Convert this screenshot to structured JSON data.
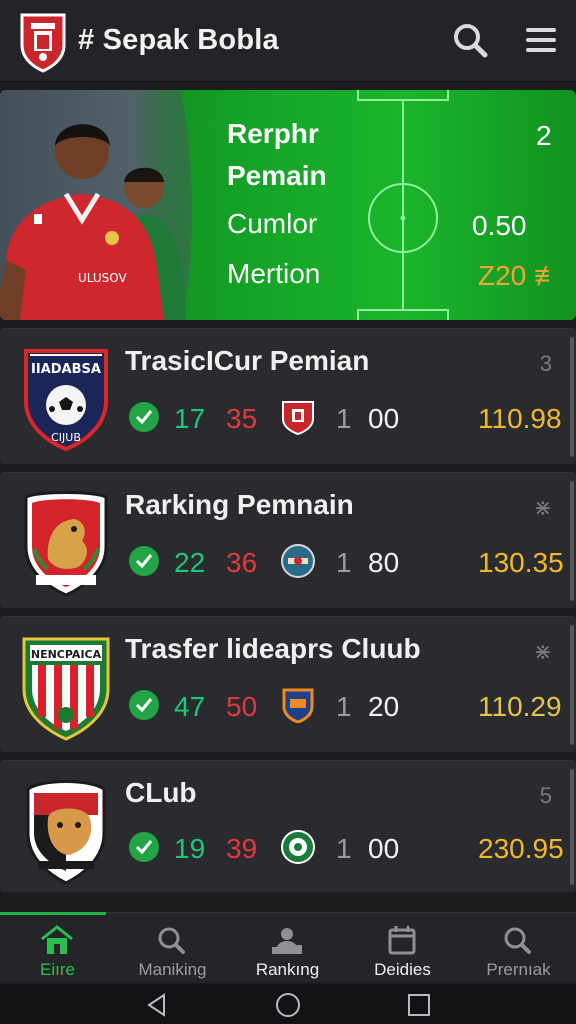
{
  "header": {
    "title": "# Sepak Bobla",
    "icons": {
      "search": "search-icon",
      "menu": "hamburger-menu-icon",
      "logo": "club-crest-logo"
    }
  },
  "hero": {
    "title_line1": "Rerphr",
    "title_line2": "Pemain",
    "label1": "Cumlor",
    "label2": "Mertion",
    "value_top": "2",
    "value1": "0.50",
    "value2": "Z20 ≢",
    "colors": {
      "field": "#16a82a",
      "highlight_value": "#f1a43b"
    }
  },
  "cards": [
    {
      "title": "TrasicICur Pemian",
      "corner": "3",
      "wins": "17",
      "losses": "35",
      "one": "1",
      "score": "00",
      "total": "110.98",
      "badge_text": "IIADABSA",
      "badge_sub": "CIJUB"
    },
    {
      "title": "Rarking Pemnain",
      "corner": "⋇",
      "wins": "22",
      "losses": "36",
      "one": "1",
      "score": "80",
      "total": "130.35"
    },
    {
      "title": "Trasfer lideaprs Cluub",
      "corner": "⋇",
      "wins": "47",
      "losses": "50",
      "one": "1",
      "score": "20",
      "total": "110.29",
      "badge_text": "NENCPAICA"
    },
    {
      "title": "CLub",
      "corner": "5",
      "wins": "19",
      "losses": "39",
      "one": "1",
      "score": "00",
      "total": "230.95"
    }
  ],
  "bottom_nav": [
    {
      "label": "Eiıre",
      "icon": "home-icon",
      "active": true
    },
    {
      "label": "Maniking",
      "icon": "search-icon"
    },
    {
      "label": "Rankıng",
      "icon": "ranking-icon"
    },
    {
      "label": "Deidies",
      "icon": "calendar-icon"
    },
    {
      "label": "Prernıak",
      "icon": "search-icon"
    }
  ],
  "status_colors": {
    "wins": "#20c77a",
    "losses": "#e2383c",
    "total": "#f3b92a",
    "accent": "#28c04f"
  }
}
